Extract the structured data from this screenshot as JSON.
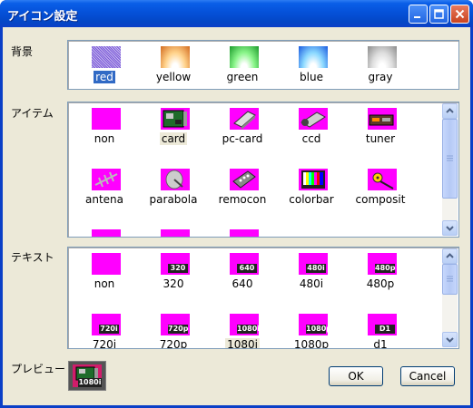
{
  "window": {
    "title": "アイコン設定"
  },
  "labels": {
    "background": "背景",
    "item": "アイテム",
    "text": "テキスト",
    "preview": "プレビュー"
  },
  "background_options": [
    {
      "label": "red",
      "selected": true,
      "icon": "red-gradient-swatch"
    },
    {
      "label": "yellow",
      "icon": "yellow-gradient-swatch"
    },
    {
      "label": "green",
      "icon": "green-gradient-swatch"
    },
    {
      "label": "blue",
      "icon": "blue-gradient-swatch"
    },
    {
      "label": "gray",
      "icon": "gray-gradient-swatch"
    }
  ],
  "item_options": [
    {
      "label": "non",
      "icon": "blank-magenta-icon"
    },
    {
      "label": "card",
      "icon": "card-icon",
      "highlighted": true
    },
    {
      "label": "pc-card",
      "icon": "pc-card-icon"
    },
    {
      "label": "ccd",
      "icon": "ccd-camera-icon"
    },
    {
      "label": "tuner",
      "icon": "tuner-icon"
    },
    {
      "label": "antena",
      "icon": "antenna-icon"
    },
    {
      "label": "parabola",
      "icon": "parabola-dish-icon"
    },
    {
      "label": "remocon",
      "icon": "remote-control-icon"
    },
    {
      "label": "colorbar",
      "icon": "colorbar-icon"
    },
    {
      "label": "composit",
      "icon": "composite-cable-icon"
    }
  ],
  "text_options": [
    {
      "label": "non",
      "badge": ""
    },
    {
      "label": "320",
      "badge": "320"
    },
    {
      "label": "640",
      "badge": "640"
    },
    {
      "label": "480i",
      "badge": "480i"
    },
    {
      "label": "480p",
      "badge": "480p"
    },
    {
      "label": "720i",
      "badge": "720i"
    },
    {
      "label": "720p",
      "badge": "720p"
    },
    {
      "label": "1080i",
      "badge": "1080i",
      "highlighted": true
    },
    {
      "label": "1080p",
      "badge": "1080p"
    },
    {
      "label": "d1",
      "badge": "D1"
    }
  ],
  "preview": {
    "badge": "1080i",
    "icon": "card-icon"
  },
  "buttons": {
    "ok": "OK",
    "cancel": "Cancel"
  },
  "colors": {
    "magenta": "#ff00ff",
    "selection": "#316ac5",
    "titlebar": "#0551d9"
  }
}
